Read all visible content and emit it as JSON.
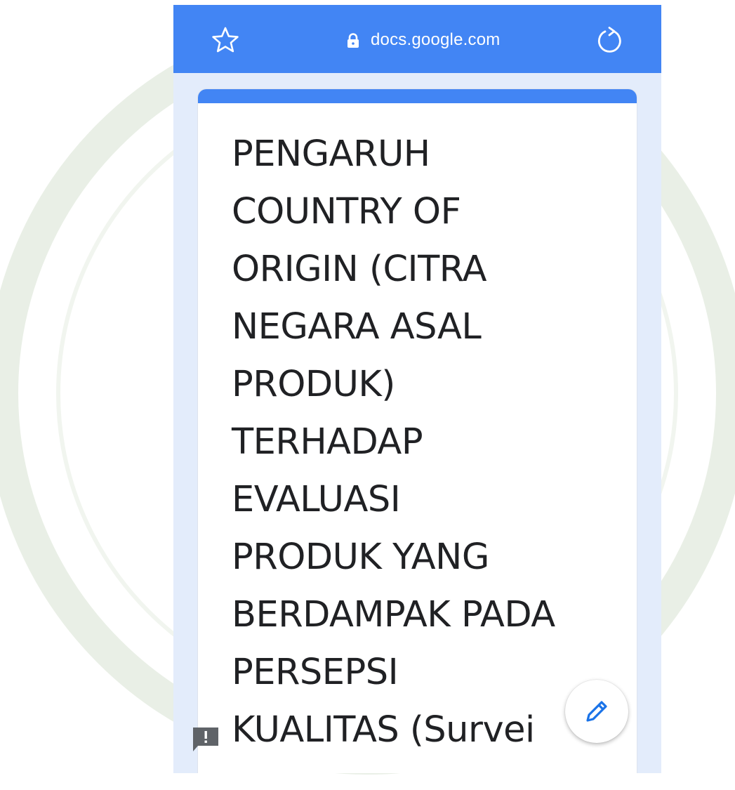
{
  "browser": {
    "url": "docs.google.com",
    "star_icon": "star-outline-icon",
    "lock_icon": "lock-icon",
    "reload_icon": "reload-icon"
  },
  "form": {
    "title_lines": [
      "PENGARUH",
      "COUNTRY OF",
      "ORIGIN (CITRA",
      "NEGARA ASAL",
      "PRODUK)",
      "TERHADAP",
      "EVALUASI",
      "PRODUK YANG",
      "BERDAMPAK PADA",
      "PERSEPSI",
      "KUALITAS (Survei"
    ]
  },
  "actions": {
    "edit_icon": "pencil-icon",
    "feedback_icon": "report-feedback-icon"
  },
  "colors": {
    "accent": "#4285f4",
    "page_background": "#e3ecfb",
    "title_text": "#202124"
  }
}
